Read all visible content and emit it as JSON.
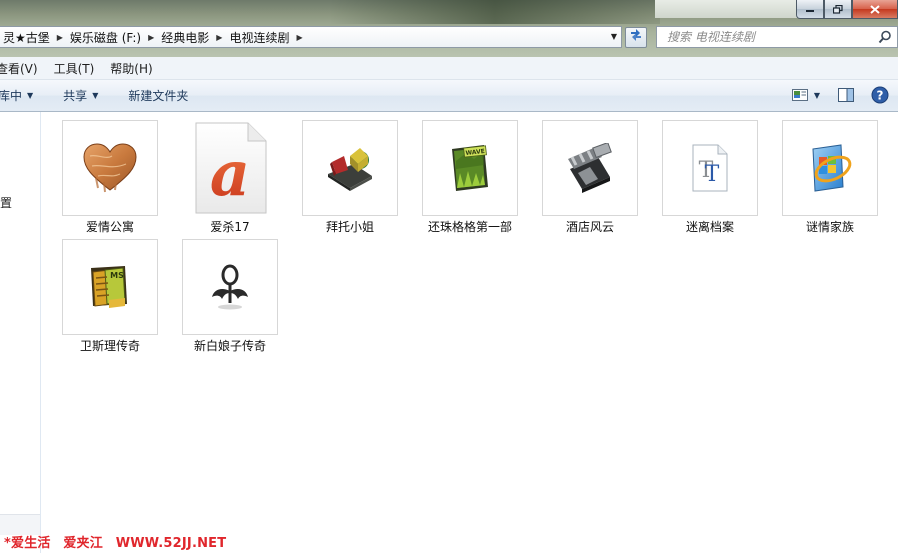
{
  "address": {
    "breadcrumbs": [
      "灵★古堡",
      "娱乐磁盘 (F:)",
      "经典电影",
      "电视连续剧"
    ]
  },
  "search": {
    "placeholder": "搜索 电视连续剧"
  },
  "menu": {
    "items": [
      "查看(V)",
      "工具(T)",
      "帮助(H)"
    ]
  },
  "toolbar": {
    "library_label": "库中",
    "share_label": "共享",
    "new_folder_label": "新建文件夹"
  },
  "navpane": {
    "partial_label": "置"
  },
  "files": [
    {
      "name": "爱情公寓",
      "icon": "heart-wood-icon"
    },
    {
      "name": "爱杀17",
      "icon": "letter-a-document-icon"
    },
    {
      "name": "拜托小姐",
      "icon": "3d-shapes-icon"
    },
    {
      "name": "还珠格格第一部",
      "icon": "wave-game-box-icon"
    },
    {
      "name": "酒店风云",
      "icon": "film-clapper-icon"
    },
    {
      "name": "迷离档案",
      "icon": "truetype-font-icon"
    },
    {
      "name": "谜情家族",
      "icon": "windows-media-icon"
    },
    {
      "name": "卫斯理传奇",
      "icon": "game-cards-icon"
    },
    {
      "name": "新白娘子传奇",
      "icon": "ornament-ring-icon"
    }
  ],
  "watermark": {
    "parts": [
      "*爱生活",
      "爱夹江",
      "WWW.52JJ.NET"
    ]
  }
}
